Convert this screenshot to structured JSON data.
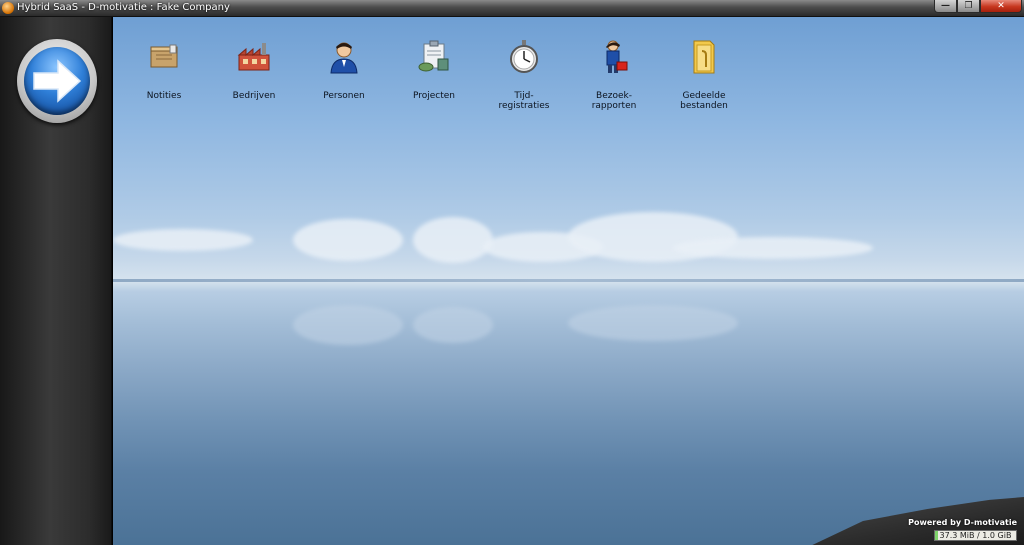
{
  "window": {
    "title": "Hybrid SaaS - D-motivatie : Fake Company",
    "minimize_icon": "minimize-icon",
    "maximize_icon": "restore-icon",
    "close_icon": "close-icon"
  },
  "sidebar": {
    "nav_button_icon": "arrow-right-icon",
    "accent": "#2f7fd8"
  },
  "desktop": {
    "icons": [
      {
        "label": "Notities",
        "icon": "notes-icon"
      },
      {
        "label": "Bedrijven",
        "icon": "factory-icon"
      },
      {
        "label": "Personen",
        "icon": "person-icon"
      },
      {
        "label": "Projecten",
        "icon": "projects-icon"
      },
      {
        "label": "Tijd-\nregistraties",
        "icon": "stopwatch-icon"
      },
      {
        "label": "Bezoek-\nrapporten",
        "icon": "visit-report-icon"
      },
      {
        "label": "Gedeelde\nbestanden",
        "icon": "shared-folder-icon"
      }
    ]
  },
  "footer": {
    "powered_by": "Powered by D-motivatie",
    "memory_label": "37.3 MiB / 1.0 GiB",
    "memory_fraction": 0.036
  }
}
